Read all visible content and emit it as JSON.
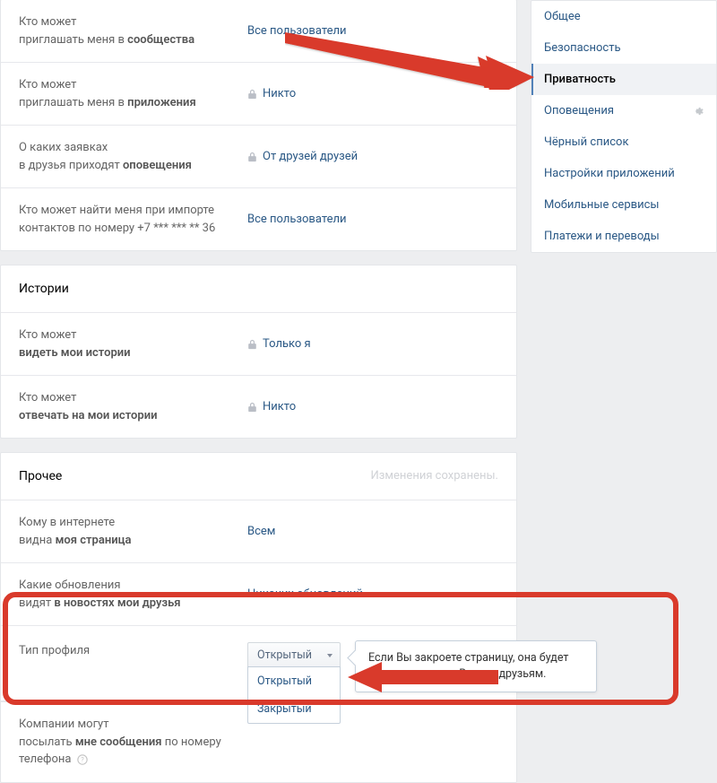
{
  "sidebar": {
    "items": [
      {
        "label": "Общее"
      },
      {
        "label": "Безопасность"
      },
      {
        "label": "Приватность"
      },
      {
        "label": "Оповещения"
      },
      {
        "label": "Чёрный список"
      },
      {
        "label": "Настройки приложений"
      },
      {
        "label": "Мобильные сервисы"
      },
      {
        "label": "Платежи и переводы"
      }
    ],
    "active_index": 2
  },
  "sections": {
    "top_rows": [
      {
        "label_lines": [
          "Кто может",
          "приглашать меня в "
        ],
        "label_bold": "сообщества",
        "value": "Все пользователи",
        "locked": false
      },
      {
        "label_lines": [
          "Кто может",
          "приглашать меня в "
        ],
        "label_bold": "приложения",
        "value": "Никто",
        "locked": true
      },
      {
        "label_lines": [
          "О каких заявках",
          "в друзья приходят "
        ],
        "label_bold": "оповещения",
        "value": "От друзей друзей",
        "locked": true
      },
      {
        "label_lines": [
          "Кто может найти меня при импорте",
          "контактов по номеру +7 *** *** ** 36"
        ],
        "label_bold": "",
        "value": "Все пользователи",
        "locked": false
      }
    ],
    "stories": {
      "header": "Истории",
      "rows": [
        {
          "label_lines": [
            "Кто может",
            ""
          ],
          "label_bold": "видеть мои истории",
          "value": "Только я",
          "locked": true
        },
        {
          "label_lines": [
            "Кто может",
            ""
          ],
          "label_bold": "отвечать на мои истории",
          "value": "Никто",
          "locked": true
        }
      ]
    },
    "other": {
      "header": "Прочее",
      "saved": "Изменения сохранены.",
      "rows": [
        {
          "label_lines": [
            "Кому в интернете",
            "видна "
          ],
          "label_bold": "моя страница",
          "value": "Всем",
          "locked": false
        },
        {
          "label_lines": [
            "Какие обновления",
            "видят "
          ],
          "label_bold": "в новостях мои друзья",
          "value": "Никаких обновлений",
          "locked": false
        }
      ],
      "profile_type": {
        "label": "Тип профиля",
        "selected": "Открытый",
        "options": [
          "Открытый",
          "Закрытый"
        ],
        "tooltip": "Если Вы закроете страницу, она будет доступна только Вашим друзьям."
      },
      "companies_row": {
        "label_lines": [
          "Компании могут",
          "посылать "
        ],
        "label_bold": "мне сообщения",
        "label_tail": " по номеру",
        "label_line3": "телефона"
      }
    }
  }
}
